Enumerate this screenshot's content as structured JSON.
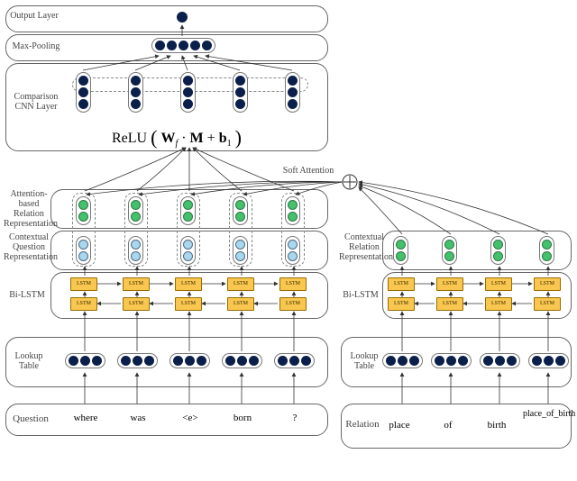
{
  "left": {
    "layers": {
      "output": "Output Layer",
      "maxpool": "Max-Pooling",
      "cnn": "Comparison CNN Layer",
      "attn_rel": "Attention-based Relation Representation",
      "ctx_q": "Contextual Question Representation",
      "bilstm": "Bi-LSTM",
      "lookup": "Lookup Table",
      "question": "Question"
    },
    "tokens": [
      "where",
      "was",
      "<e>",
      "born",
      "?"
    ],
    "formula_parts": {
      "relu": "ReLU",
      "open": "(",
      "w": "W",
      "sub_f": "f",
      "dot": " · ",
      "m": "M",
      "plus": " + ",
      "b": "b",
      "sub_1": "1",
      "close": ")"
    }
  },
  "right": {
    "layers": {
      "soft": "Soft Attention",
      "ctx_r": "Contextual Relation Representation",
      "bilstm": "Bi-LSTM",
      "lookup": "Lookup Table",
      "relation": "Relation"
    },
    "tokens": [
      "place",
      "of",
      "birth",
      "place_of_birth"
    ]
  },
  "lstm_label": "LSTM",
  "chart_data": {
    "type": "diagram",
    "architecture": {
      "question_branch": {
        "input_tokens": [
          "where",
          "was",
          "<e>",
          "born",
          "?"
        ],
        "layers_bottom_to_top": [
          "Lookup Table (3-dim embedding shown)",
          "Bi-LSTM (two stacked LSTM rows, bidirectional)",
          "Contextual Question Representation (2-dim vectors)",
          "Attention-based Relation Representation (2-dim vectors, attention from relation branch)",
          "Comparison CNN Layer: ReLU(W_f · M + b_1)",
          "Max-Pooling",
          "Output Layer (scalar)"
        ],
        "positions": 5,
        "cnn_kernel_slide": "dashed window slides over 3-dim feature columns"
      },
      "relation_branch": {
        "input_tokens": [
          "place",
          "of",
          "birth",
          "place_of_birth"
        ],
        "layers_bottom_to_top": [
          "Lookup Table (3-dim embedding shown)",
          "Bi-LSTM (two stacked LSTM rows, bidirectional)",
          "Contextual Relation Representation (2-dim vectors)"
        ],
        "positions": 4
      },
      "interaction": {
        "soft_attention": "Relation contextual vectors feed Soft Attention ⊕, which attends over question positions to form Attention-based Relation Representation",
        "comparison": "Dashed pairing of question-context and attention-relation vectors feeds Comparison CNN Layer"
      }
    }
  }
}
